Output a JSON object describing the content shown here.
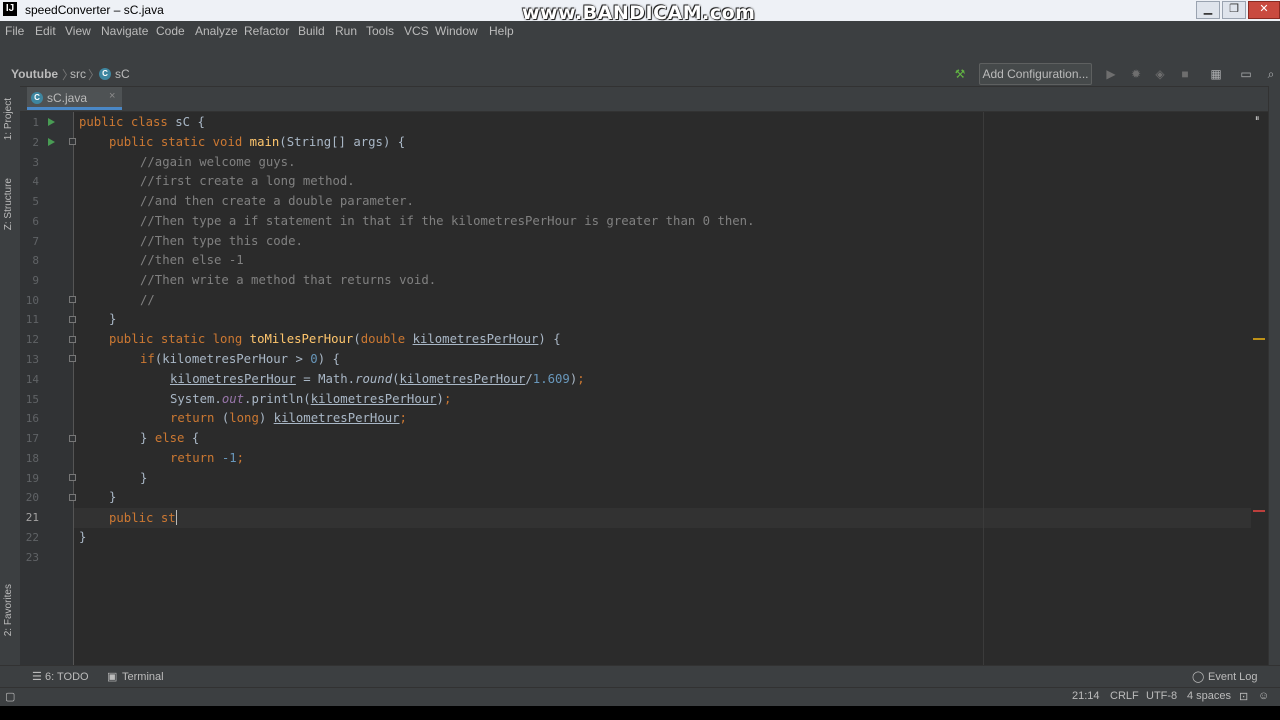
{
  "window": {
    "title": "speedConverter – sC.java",
    "app_icon": "IJ",
    "watermark": "www.BANDICAM.com"
  },
  "menu": [
    "File",
    "Edit",
    "View",
    "Navigate",
    "Code",
    "Analyze",
    "Refactor",
    "Build",
    "Run",
    "Tools",
    "VCS",
    "Window",
    "Help"
  ],
  "breadcrumb": {
    "project": "Youtube",
    "folder": "src",
    "file": "sC"
  },
  "toolbar": {
    "add_configuration": "Add Configuration...",
    "icons": [
      "hammer-icon",
      "run-icon",
      "debug-icon",
      "coverage-icon",
      "stop-icon",
      "project-structure-icon",
      "layout-icon",
      "search-icon"
    ]
  },
  "tab": {
    "label": "sC.java",
    "close": "×"
  },
  "left_tools": {
    "project": "1: Project",
    "structure": "Z: Structure",
    "favorites": "2: Favorites"
  },
  "editor": {
    "line_count": 23,
    "current_line": 21,
    "code_lines": [
      "public class sC {",
      "public static void main(String[] args) {",
      "//again welcome guys.",
      "//first create a long method.",
      "//and then create a double parameter.",
      "//Then type a if statement in that if the kilometresPerHour is greater than 0 then.",
      "//Then type this code.",
      "//then else -1",
      "//Then write a method that returns void.",
      "//",
      "}",
      "public static long toMilesPerHour(double kilometresPerHour) {",
      "if(kilometresPerHour > 0) {",
      "kilometresPerHour = Math.round(kilometresPerHour/1.609);",
      "System.out.println(kilometresPerHour);",
      "return (long) kilometresPerHour;",
      "} else {",
      "return -1;",
      "}",
      "}",
      "public st",
      "}",
      ""
    ]
  },
  "bottom_tools": {
    "todo": "6: TODO",
    "terminal": "Terminal",
    "event_log": "Event Log"
  },
  "status": {
    "position": "21:14",
    "line_separator": "CRLF",
    "encoding": "UTF-8",
    "indent": "4 spaces"
  },
  "colors": {
    "editor_bg": "#2b2b2b",
    "gutter_bg": "#313335",
    "keyword": "#cc7832",
    "comment": "#808080",
    "method": "#ffc66d",
    "number": "#6897bb",
    "accent": "#4a88c7"
  }
}
